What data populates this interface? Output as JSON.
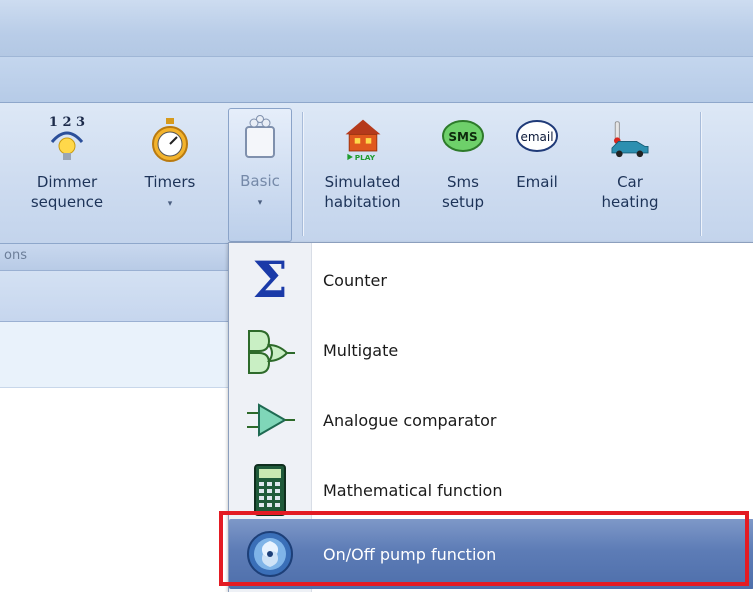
{
  "ribbon": {
    "group_caption": "ons",
    "buttons": [
      {
        "label1": "Dimmer",
        "label2": "sequence",
        "icon": "dimmer-sequence-icon"
      },
      {
        "label1": "Timers",
        "arrow": "▾",
        "icon": "stopwatch-icon"
      },
      {
        "label1": "Basic",
        "arrow": "▾",
        "icon": "blocks-icon"
      },
      {
        "label1": "Simulated",
        "label2": "habitation",
        "icon": "house-play-icon",
        "icon_text": "PLAY"
      },
      {
        "label1": "Sms",
        "label2": "setup",
        "icon": "sms-icon",
        "icon_text": "SMS"
      },
      {
        "label1": "Email",
        "icon": "email-icon",
        "icon_text": "email"
      },
      {
        "label1": "Car",
        "label2": "heating",
        "icon": "car-heating-icon"
      }
    ],
    "dimmer_digits": "1 2 3"
  },
  "dropdown": {
    "items": [
      {
        "label": "Counter",
        "icon": "sigma-icon",
        "glyph": "Σ"
      },
      {
        "label": "Multigate",
        "icon": "logic-gates-icon"
      },
      {
        "label": "Analogue comparator",
        "icon": "comparator-icon"
      },
      {
        "label": "Mathematical function",
        "icon": "calculator-icon"
      },
      {
        "label": "On/Off pump function",
        "icon": "pump-icon",
        "highlighted": true
      }
    ]
  },
  "colors": {
    "highlight": "#5d7cb6",
    "annotation": "#e31b23",
    "ribbon": "#cedcf0"
  }
}
